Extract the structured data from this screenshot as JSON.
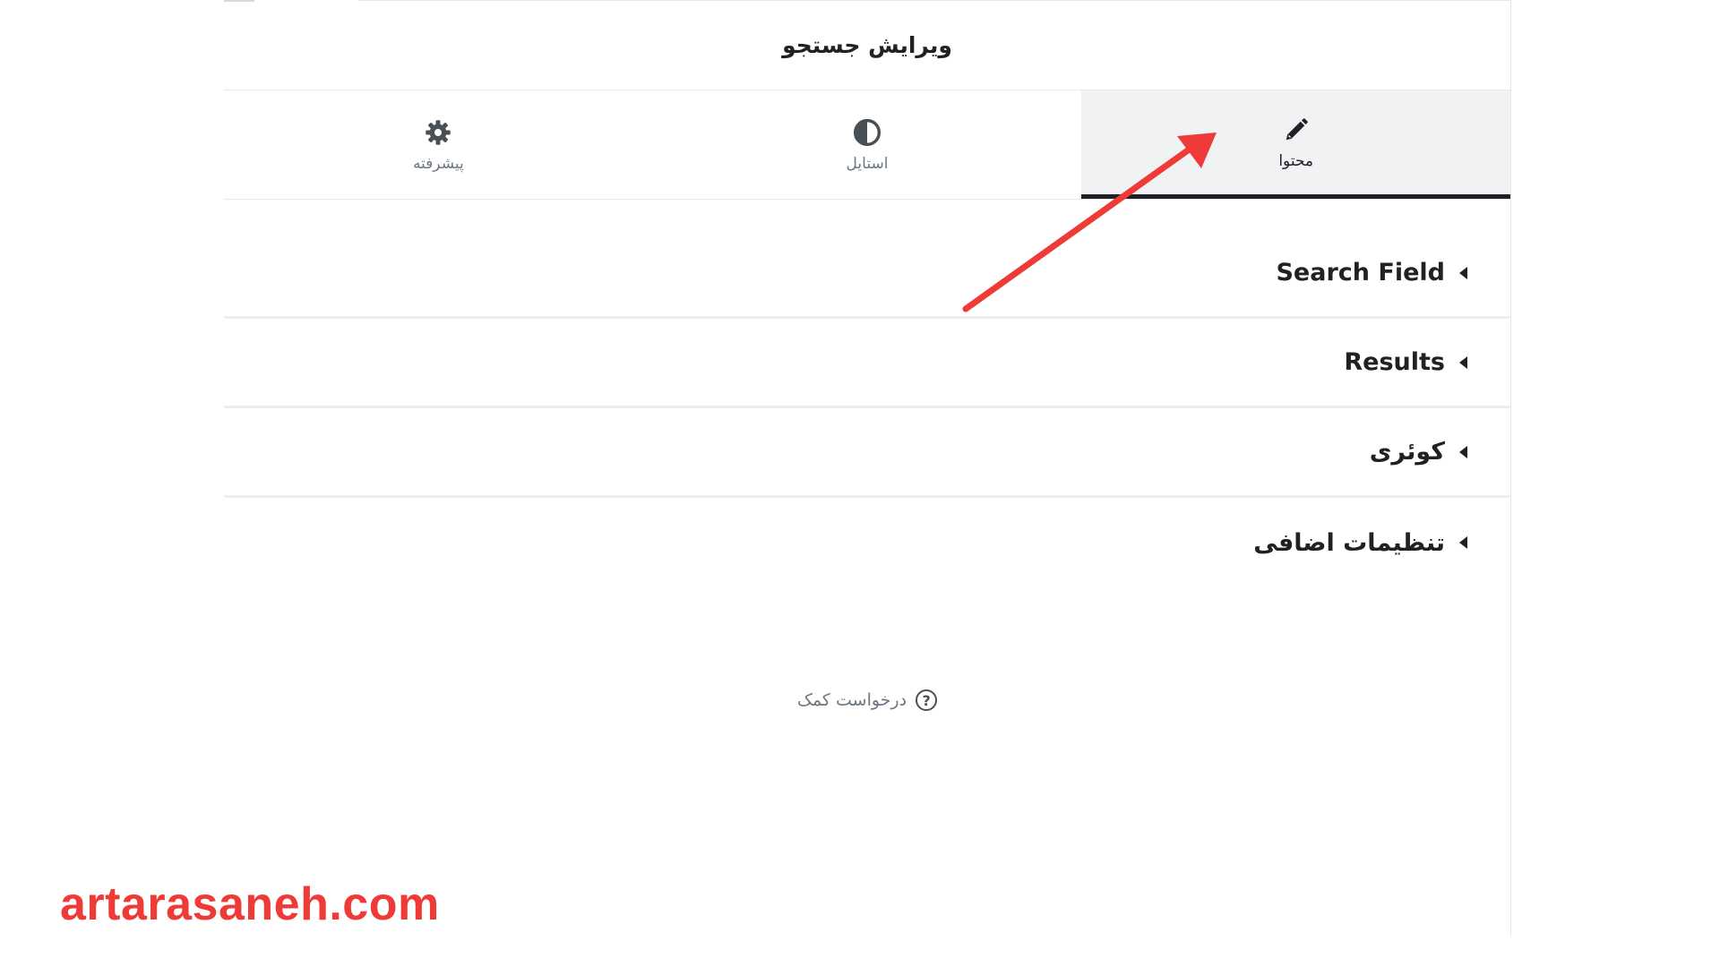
{
  "panel": {
    "title": "ویرایش جستجو"
  },
  "tabs": [
    {
      "label": "محتوا",
      "icon": "pencil-icon",
      "active": true
    },
    {
      "label": "استایل",
      "icon": "half-circle-icon",
      "active": false
    },
    {
      "label": "پیشرفته",
      "icon": "gear-icon",
      "active": false
    }
  ],
  "sections": [
    {
      "label": "Search Field"
    },
    {
      "label": "Results"
    },
    {
      "label": "کوئری"
    },
    {
      "label": "تنظیمات اضافی"
    }
  ],
  "help": {
    "label": "درخواست کمک",
    "icon_glyph": "?"
  },
  "annotation": {
    "arrow_color": "#ee3b37"
  },
  "watermark": {
    "text": "artarasaneh.com",
    "color": "#ee3b37"
  }
}
